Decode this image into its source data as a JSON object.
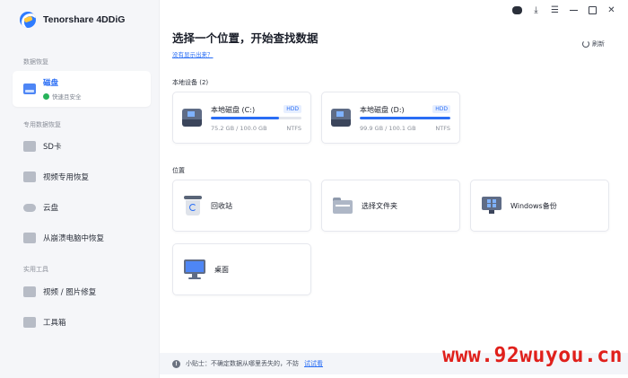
{
  "app": {
    "name": "Tenorshare 4DDiG"
  },
  "sidebar": {
    "section_recovery": "数据恢复",
    "disk": {
      "label": "磁盘",
      "sub": "快速且安全"
    },
    "section_special": "专用数据恢复",
    "special_items": [
      {
        "label": "SD卡",
        "icon": "sd-card-icon"
      },
      {
        "label": "视频专用恢复",
        "icon": "video-icon"
      },
      {
        "label": "云盘",
        "icon": "cloud-icon"
      },
      {
        "label": "从崩溃电脑中恢复",
        "icon": "crashed-pc-icon"
      }
    ],
    "section_tools": "实用工具",
    "tool_items": [
      {
        "label": "视频 / 图片修复",
        "icon": "repair-icon"
      },
      {
        "label": "工具箱",
        "icon": "toolbox-icon"
      }
    ]
  },
  "main": {
    "title": "选择一个位置，开始查找数据",
    "hint_link": "没有显示出来？",
    "refresh_label": "刷新",
    "local_devices_label": "本地设备 (2)",
    "drives": [
      {
        "name": "本地磁盘 (C:)",
        "type": "HDD",
        "size": "75.2 GB / 100.0 GB",
        "fs": "NTFS",
        "used_fraction": 0.752
      },
      {
        "name": "本地磁盘 (D:)",
        "type": "HDD",
        "size": "99.9 GB / 100.1 GB",
        "fs": "NTFS",
        "used_fraction": 0.998
      }
    ],
    "locations_label": "位置",
    "locations": [
      {
        "label": "回收站",
        "icon": "recycle-bin-icon"
      },
      {
        "label": "选择文件夹",
        "icon": "folder-icon"
      },
      {
        "label": "Windows备份",
        "icon": "windows-backup-icon"
      },
      {
        "label": "桌面",
        "icon": "desktop-icon"
      }
    ],
    "tip": {
      "prefix": "小贴士：不确定数据从哪里丢失的，不妨",
      "link": "试试看"
    }
  },
  "watermark": "www.92wuyou.cn",
  "colors": {
    "accent": "#2a6ef5",
    "watermark": "#e0201b"
  }
}
